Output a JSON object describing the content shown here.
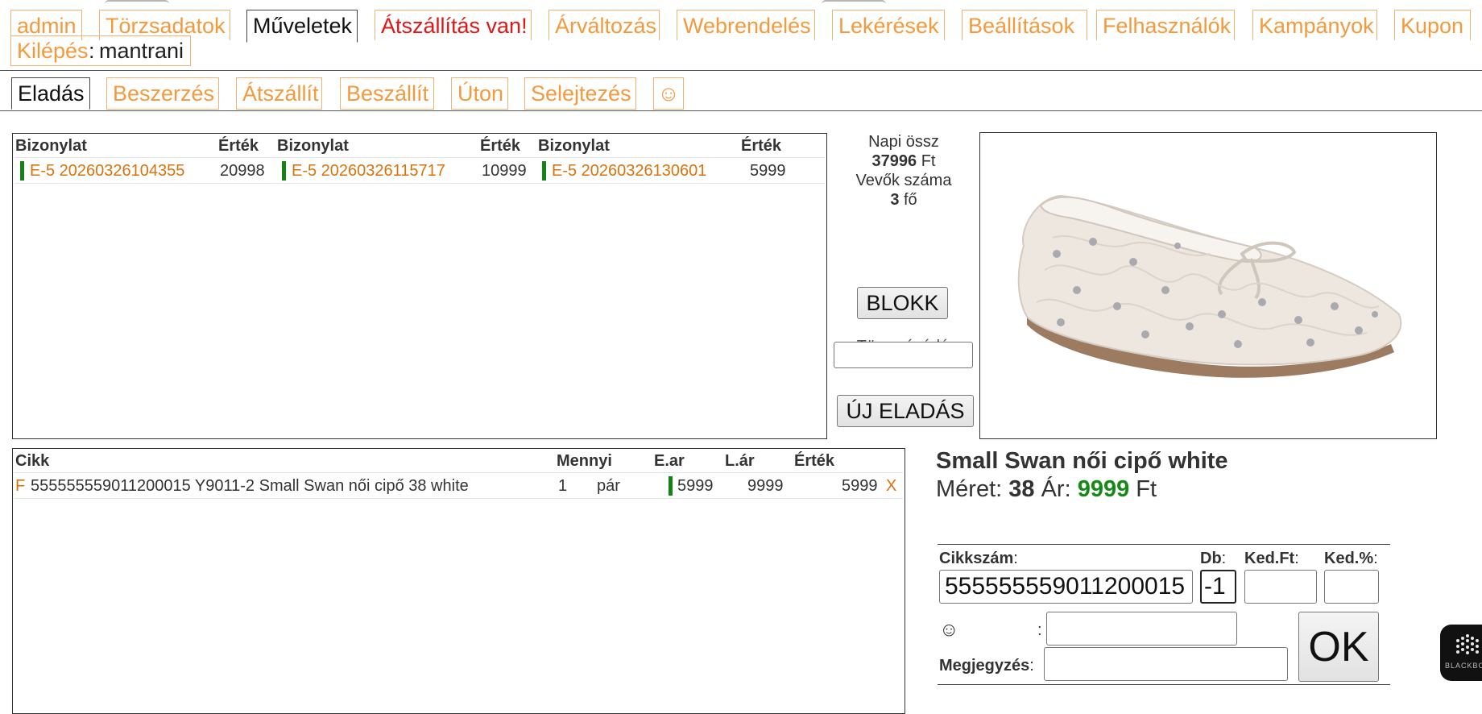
{
  "topnav": {
    "tabs": [
      {
        "label": "admin"
      },
      {
        "label": "Törzsadatok"
      },
      {
        "label": "Műveletek"
      },
      {
        "label": "Átszállítás van!"
      },
      {
        "label": "Árváltozás"
      },
      {
        "label": "Webrendelés"
      },
      {
        "label": "Lekérések"
      },
      {
        "label": "Beállítások"
      },
      {
        "label": "Felhasználók"
      },
      {
        "label": "Kampányok"
      },
      {
        "label": "Kupon"
      }
    ],
    "logout_label": "Kilépés",
    "logout_sep": ":",
    "username": "mantrani"
  },
  "subnav": {
    "tabs": [
      {
        "label": "Eladás"
      },
      {
        "label": "Beszerzés"
      },
      {
        "label": "Átszállít"
      },
      {
        "label": "Beszállít"
      },
      {
        "label": "Úton"
      },
      {
        "label": "Selejtezés"
      },
      {
        "label": "☺"
      }
    ]
  },
  "receipts": {
    "headers": {
      "doc": "Bizonylat",
      "value": "Érték"
    },
    "rows": [
      {
        "doc": "E-5 20260326104355",
        "value": "20998"
      },
      {
        "doc": "E-5 20260326115717",
        "value": "10999"
      },
      {
        "doc": "E-5 20260326130601",
        "value": "5999"
      }
    ]
  },
  "summary": {
    "daily_label": "Napi össz",
    "daily_value": "37996",
    "currency": "Ft",
    "customers_label": "Vevők száma",
    "customers_value": "3",
    "customers_unit": "fő"
  },
  "buttons": {
    "blokk": "BLOKK",
    "new_sale": "ÚJ ELADÁS",
    "ok": "OK",
    "cut_label": "Törzsvásárló"
  },
  "items": {
    "headers": {
      "cikk": "Cikk",
      "qty": "Mennyi",
      "unit_price": "E.ar",
      "list_price": "L.ár",
      "value": "Érték"
    },
    "rows": [
      {
        "flag": "F",
        "desc": "555555559011200015 Y9011-2 Small Swan női cipő 38 white",
        "qty": "1",
        "unit": "pár",
        "unit_price": "5999",
        "list_price": "9999",
        "value": "5999",
        "remove": "X"
      }
    ]
  },
  "product": {
    "name": "Small Swan női cipő white",
    "size_label": "Méret:",
    "size": "38",
    "price_label": "Ár:",
    "price": "9999",
    "currency": "Ft"
  },
  "form": {
    "cikkszam_label": "Cikkszám",
    "cikkszam_value": "555555559011200015",
    "db_label": "Db",
    "db_value": "-1",
    "kedft_label": "Ked.Ft",
    "kedpct_label": "Ked.%",
    "smiley_label": "☺",
    "colon": ":",
    "note_label": "Megjegyzés"
  },
  "badge": {
    "text": "BLACKBOX"
  },
  "colors": {
    "link": "#f49a3d",
    "alert": "#e31616",
    "green": "#158a15"
  }
}
